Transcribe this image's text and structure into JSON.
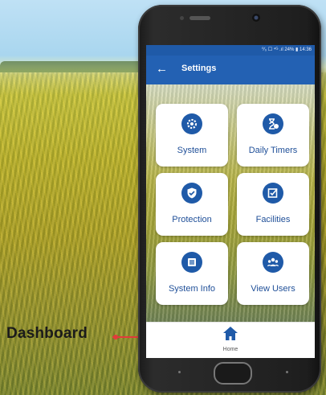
{
  "callout": {
    "label": "Dashboard"
  },
  "status_bar": {
    "text": "⁰⁄₀ ☐ ⁴ᴳ .ıl 24% ▮ 14:36"
  },
  "app_bar": {
    "title": "Settings",
    "back_icon": "arrow-left-icon"
  },
  "tiles": [
    {
      "label": "System",
      "icon": "gear-icon"
    },
    {
      "label": "Daily Timers",
      "icon": "hourglass-clock-icon"
    },
    {
      "label": "Protection",
      "icon": "shield-check-icon"
    },
    {
      "label": "Facilities",
      "icon": "checklist-icon"
    },
    {
      "label": "System Info",
      "icon": "info-panel-icon"
    },
    {
      "label": "View Users",
      "icon": "users-icon"
    }
  ],
  "bottom_nav": {
    "home_label": "Home",
    "home_icon": "home-icon"
  },
  "colors": {
    "primary": "#2361b3",
    "status_bar": "#1f5aa8",
    "tile_text": "#1f4f98",
    "callout_line": "#e23b3b"
  }
}
